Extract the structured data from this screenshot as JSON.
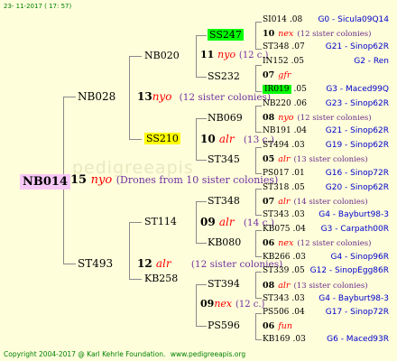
{
  "header": {
    "date": "23- 11-2017 ( 17: 57)"
  },
  "footer": {
    "copyright": "Copyright 2004-2017 @ Karl Kehrle Foundation.",
    "url": "www.pedigreeapis.org"
  },
  "watermark": "pedigreeapis",
  "root": {
    "id": "NB014",
    "year": "15",
    "type": "nyo",
    "note": "(Drones from 10 sister colonies)"
  },
  "gen1": [
    {
      "id": "NB028"
    },
    {
      "id": "ST493"
    }
  ],
  "gen2": [
    {
      "id": "NB020",
      "year": "13",
      "type": "nyo",
      "note": "(12 sister colonies)"
    },
    {
      "id": "SS210",
      "year": "10",
      "type": "alr",
      "note": "(13 c.)"
    },
    {
      "id": "ST114",
      "year": "09",
      "type": "alr",
      "note": "(14 c.)"
    },
    {
      "id": "KB258",
      "year": "12",
      "type": "alr",
      "note": "(12 sister colonies)"
    }
  ],
  "gen3": [
    {
      "id": "SS247",
      "year": "11",
      "type": "nyo",
      "note": "(12 c.)"
    },
    {
      "id": "SS232"
    },
    {
      "id": "NB069"
    },
    {
      "id": "ST345"
    },
    {
      "id": "ST348",
      "year": "07",
      "type": "alr",
      "note": "(14 c.)"
    },
    {
      "id": "KB080"
    },
    {
      "id": "ST394",
      "year": "09",
      "type": "nex",
      "note": "(12 c.)"
    },
    {
      "id": "PS596"
    }
  ],
  "gen4": [
    {
      "id": "SI014",
      "date": ".08",
      "map": "G0 - Sicula09Q14"
    },
    {
      "year": "10",
      "type": "nex",
      "note": "(12 sister colonies)"
    },
    {
      "id": "ST348",
      "date": ".07",
      "map": "G21 - Sinop62R"
    },
    {
      "id": "IN152",
      "date": ".05",
      "map": "G2 - Ren"
    },
    {
      "year": "07",
      "type": "gfr"
    },
    {
      "id": "IR019",
      "date": ".05",
      "map": "G3 - Maced99Q"
    },
    {
      "id": "NB220",
      "date": ".06",
      "map": "G23 - Sinop62R"
    },
    {
      "year": "08",
      "type": "nyo",
      "note": "(12 sister colonies)"
    },
    {
      "id": "NB191",
      "date": ".04",
      "map": "G21 - Sinop62R"
    },
    {
      "id": "ST494",
      "date": ".03",
      "map": "G19 - Sinop62R"
    },
    {
      "year": "05",
      "type": "alr",
      "note": "(13 sister colonies)"
    },
    {
      "id": "PS017",
      "date": ".01",
      "map": "G16 - Sinop72R"
    },
    {
      "id": "ST318",
      "date": ".05",
      "map": "G20 - Sinop62R"
    },
    {
      "year": "07",
      "type": "alr",
      "note": "(14 sister colonies)"
    },
    {
      "id": "ST343",
      "date": ".03",
      "map": "G4 - Bayburt98-3"
    },
    {
      "id": "KB075",
      "date": ".04",
      "map": "G3 - Carpath00R"
    },
    {
      "year": "06",
      "type": "nex",
      "note": "(12 sister colonies)"
    },
    {
      "id": "KB266",
      "date": ".03",
      "map": "G4 - Sinop96R"
    },
    {
      "id": "ST339",
      "date": ".05",
      "map": "G12 - SinopEgg86R"
    },
    {
      "year": "08",
      "type": "alr",
      "note": "(13 sister colonies)"
    },
    {
      "id": "ST343",
      "date": ".03",
      "map": "G4 - Bayburt98-3"
    },
    {
      "id": "PS506",
      "date": ".04",
      "map": "G17 - Sinop72R"
    },
    {
      "year": "06",
      "type": "fun"
    },
    {
      "id": "KB169",
      "date": ".03",
      "map": "G6 - Maced93R"
    }
  ],
  "colors": {
    "background": "#fefedb",
    "green_highlight": "#00ff00",
    "yellow_highlight": "#ffff00",
    "root_highlight": "#f6c8f6",
    "type_red": "#ff0000",
    "map_blue": "#0000cc"
  }
}
